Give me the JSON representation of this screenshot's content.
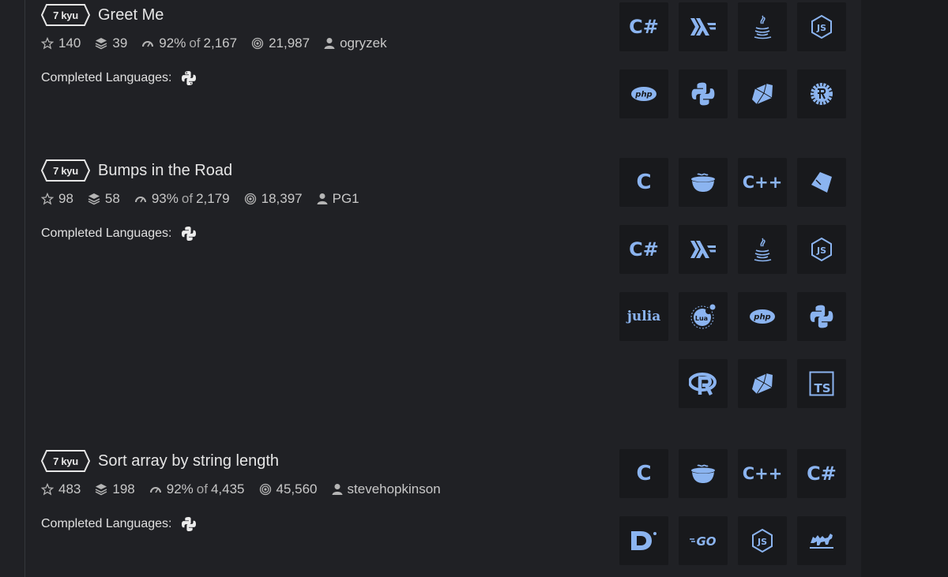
{
  "katas": [
    {
      "rank": "7 kyu",
      "title": "Greet Me",
      "stars": "140",
      "collections": "39",
      "satisfaction": "92%",
      "of_label": "of",
      "votes": "2,167",
      "completions": "21,987",
      "author": "ogryzek",
      "completed_label": "Completed Languages:",
      "languages": [
        "csharp",
        "haskell",
        "java",
        "javascript",
        "php",
        "python",
        "ruby",
        "rust"
      ]
    },
    {
      "rank": "7 kyu",
      "title": "Bumps in the Road",
      "stars": "98",
      "collections": "58",
      "satisfaction": "93%",
      "of_label": "of",
      "votes": "2,179",
      "completions": "18,397",
      "author": "PG1",
      "completed_label": "Completed Languages:",
      "languages": [
        "c",
        "coffeescript",
        "cpp",
        "elixir",
        "csharp",
        "haskell",
        "java",
        "javascript",
        "julia",
        "lua",
        "php",
        "python",
        "r",
        "ruby",
        "typescript"
      ]
    },
    {
      "rank": "7 kyu",
      "title": "Sort array by string length",
      "stars": "483",
      "collections": "198",
      "satisfaction": "92%",
      "of_label": "of",
      "votes": "4,435",
      "completions": "45,560",
      "author": "stevehopkinson",
      "completed_label": "Completed Languages:",
      "languages": [
        "c",
        "coffeescript",
        "cpp",
        "csharp",
        "dart",
        "go",
        "javascript",
        "ocaml"
      ]
    }
  ],
  "lang_text": {
    "c": "C",
    "cpp": "C++",
    "csharp": "C#",
    "php": "php",
    "julia": "julia",
    "lua": "Lua",
    "typescript": "TS",
    "go": "GO",
    "js": "JS"
  },
  "colors": {
    "accent": "#8bb4f0",
    "background": "#202125",
    "tile": "#18191c"
  }
}
